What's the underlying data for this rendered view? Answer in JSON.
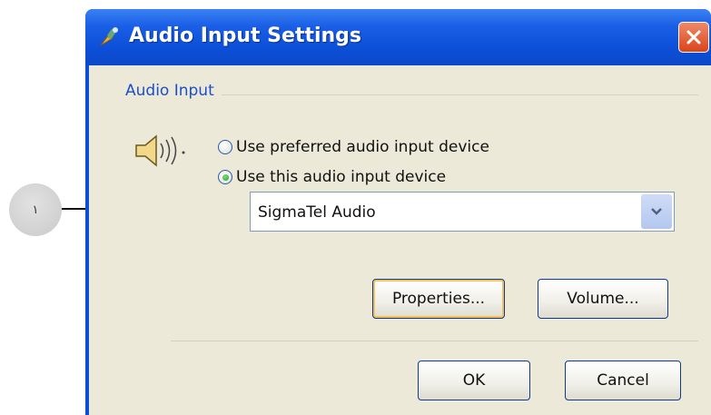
{
  "callout": {
    "number": "١"
  },
  "window": {
    "title": "Audio Input Settings",
    "close_label": "×"
  },
  "group": {
    "label": "Audio Input"
  },
  "options": {
    "preferred_label": "Use preferred audio input device",
    "this_device_label": "Use this audio input device",
    "selected": "this_device"
  },
  "device_select": {
    "value": "SigmaTel Audio"
  },
  "buttons": {
    "properties": "Properties...",
    "volume": "Volume...",
    "ok": "OK",
    "cancel": "Cancel"
  },
  "colors": {
    "titlebar": "#0c4fd8",
    "client_bg": "#ece9d8",
    "group_label": "#1b4fc9",
    "close_button": "#d9441b"
  }
}
